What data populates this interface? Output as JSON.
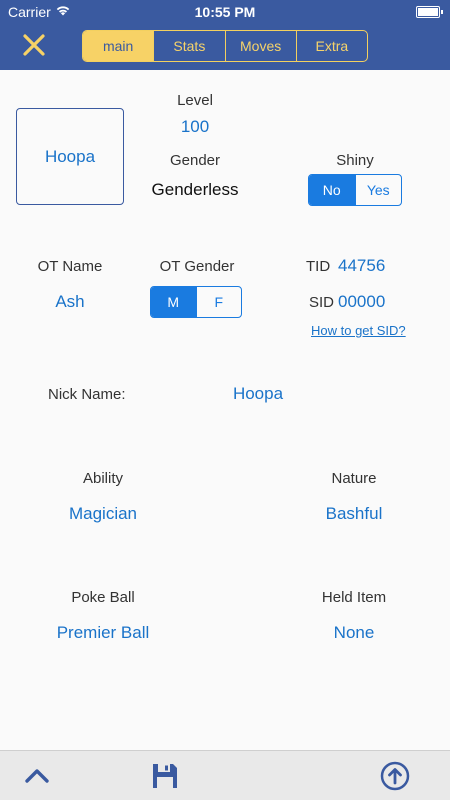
{
  "status_bar": {
    "carrier": "Carrier",
    "time": "10:55 PM",
    "battery_level": 1.0
  },
  "nav": {
    "close_icon": "close-icon",
    "tabs": [
      {
        "label": "main",
        "active": true
      },
      {
        "label": "Stats",
        "active": false
      },
      {
        "label": "Moves",
        "active": false
      },
      {
        "label": "Extra",
        "active": false
      }
    ]
  },
  "pokemon": {
    "name": "Hoopa"
  },
  "level": {
    "label": "Level",
    "value": "100"
  },
  "gender": {
    "label": "Gender",
    "value": "Genderless"
  },
  "shiny": {
    "label": "Shiny",
    "options": [
      "No",
      "Yes"
    ],
    "selected": "No"
  },
  "ot": {
    "name_label": "OT Name",
    "name_value": "Ash",
    "gender_label": "OT Gender",
    "gender_options": [
      "M",
      "F"
    ],
    "gender_selected": "M",
    "tid_label": "TID",
    "tid_value": "44756",
    "sid_label": "SID",
    "sid_value": "00000",
    "sid_help": "How to get SID?"
  },
  "nickname": {
    "label": "Nick Name:",
    "value": "Hoopa"
  },
  "ability": {
    "label": "Ability",
    "value": "Magician"
  },
  "nature": {
    "label": "Nature",
    "value": "Bashful"
  },
  "poke_ball": {
    "label": "Poke Ball",
    "value": "Premier Ball"
  },
  "held_item": {
    "label": "Held Item",
    "value": "None"
  },
  "toolbar": {
    "icons": [
      "chevron-up-icon",
      "save-icon",
      "upload-icon"
    ]
  },
  "colors": {
    "nav_bg": "#3a5aa0",
    "accent_yellow": "#f7d266",
    "link_blue": "#1a73c9",
    "segment_blue": "#1a7be0"
  }
}
